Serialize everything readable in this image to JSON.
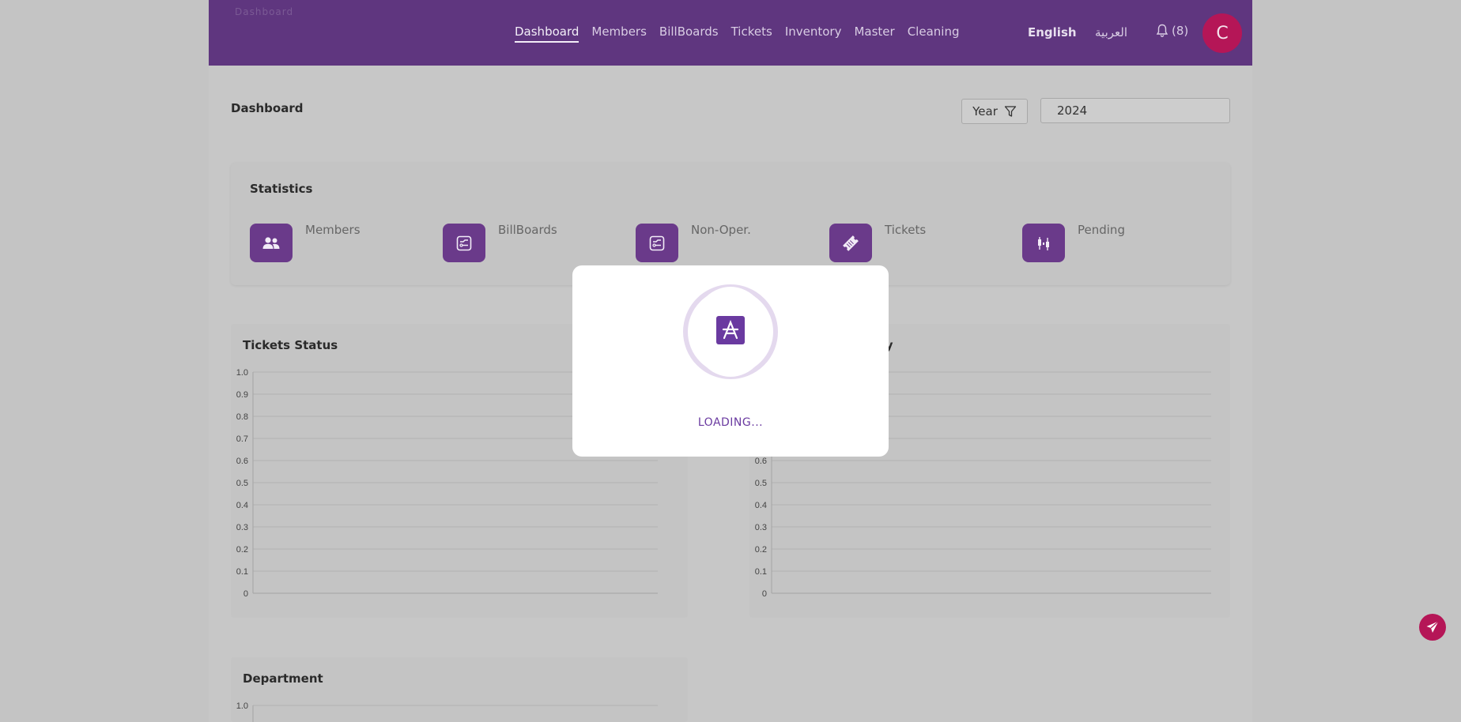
{
  "header": {
    "logo_text": "Dashboard",
    "nav": [
      {
        "label": "Dashboard",
        "active": true
      },
      {
        "label": "Members",
        "active": false
      },
      {
        "label": "BillBoards",
        "active": false
      },
      {
        "label": "Tickets",
        "active": false
      },
      {
        "label": "Inventory",
        "active": false
      },
      {
        "label": "Master",
        "active": false
      },
      {
        "label": "Cleaning",
        "active": false
      }
    ],
    "lang_en": "English",
    "lang_ar": "العربية",
    "notifications": "(8)",
    "avatar_initial": "C"
  },
  "page": {
    "title": "Dashboard",
    "filter_label": "Year",
    "year_value": "2024"
  },
  "statistics": {
    "title": "Statistics",
    "items": [
      {
        "label": "Members",
        "icon": "users-icon"
      },
      {
        "label": "BillBoards",
        "icon": "billboard-icon"
      },
      {
        "label": "Non-Oper.",
        "icon": "billboard-icon"
      },
      {
        "label": "Tickets",
        "icon": "ticket-icon"
      },
      {
        "label": "Pending",
        "icon": "candlestick-icon"
      }
    ]
  },
  "charts": {
    "tickets_status": {
      "title": "Tickets Status"
    },
    "priority": {
      "title": "rity"
    },
    "department": {
      "title": "Department"
    }
  },
  "chart_data": [
    {
      "type": "bar",
      "title": "Tickets Status",
      "categories": [],
      "series": [],
      "ylim": [
        0,
        1.0
      ],
      "yticks": [
        "1.0",
        "0.9",
        "0.8",
        "0.7",
        "0.6",
        "0.5",
        "0.4",
        "0.3",
        "0.2",
        "0.1",
        "0"
      ],
      "grid": true
    },
    {
      "type": "bar",
      "title": "rity",
      "categories": [],
      "series": [],
      "ylim": [
        0,
        1.0
      ],
      "yticks": [
        "0.6",
        "0.5",
        "0.4",
        "0.3",
        "0.2",
        "0.1",
        "0"
      ],
      "grid": true
    },
    {
      "type": "bar",
      "title": "Department",
      "categories": [],
      "series": [],
      "ylim": [
        0,
        1.0
      ],
      "yticks": [
        "1.0"
      ],
      "grid": true
    }
  ],
  "modal": {
    "loading_text": "LOADING..."
  },
  "colors": {
    "brand": "#5f367f",
    "accent": "#b51657",
    "icon_bg": "#6a3a8a"
  }
}
